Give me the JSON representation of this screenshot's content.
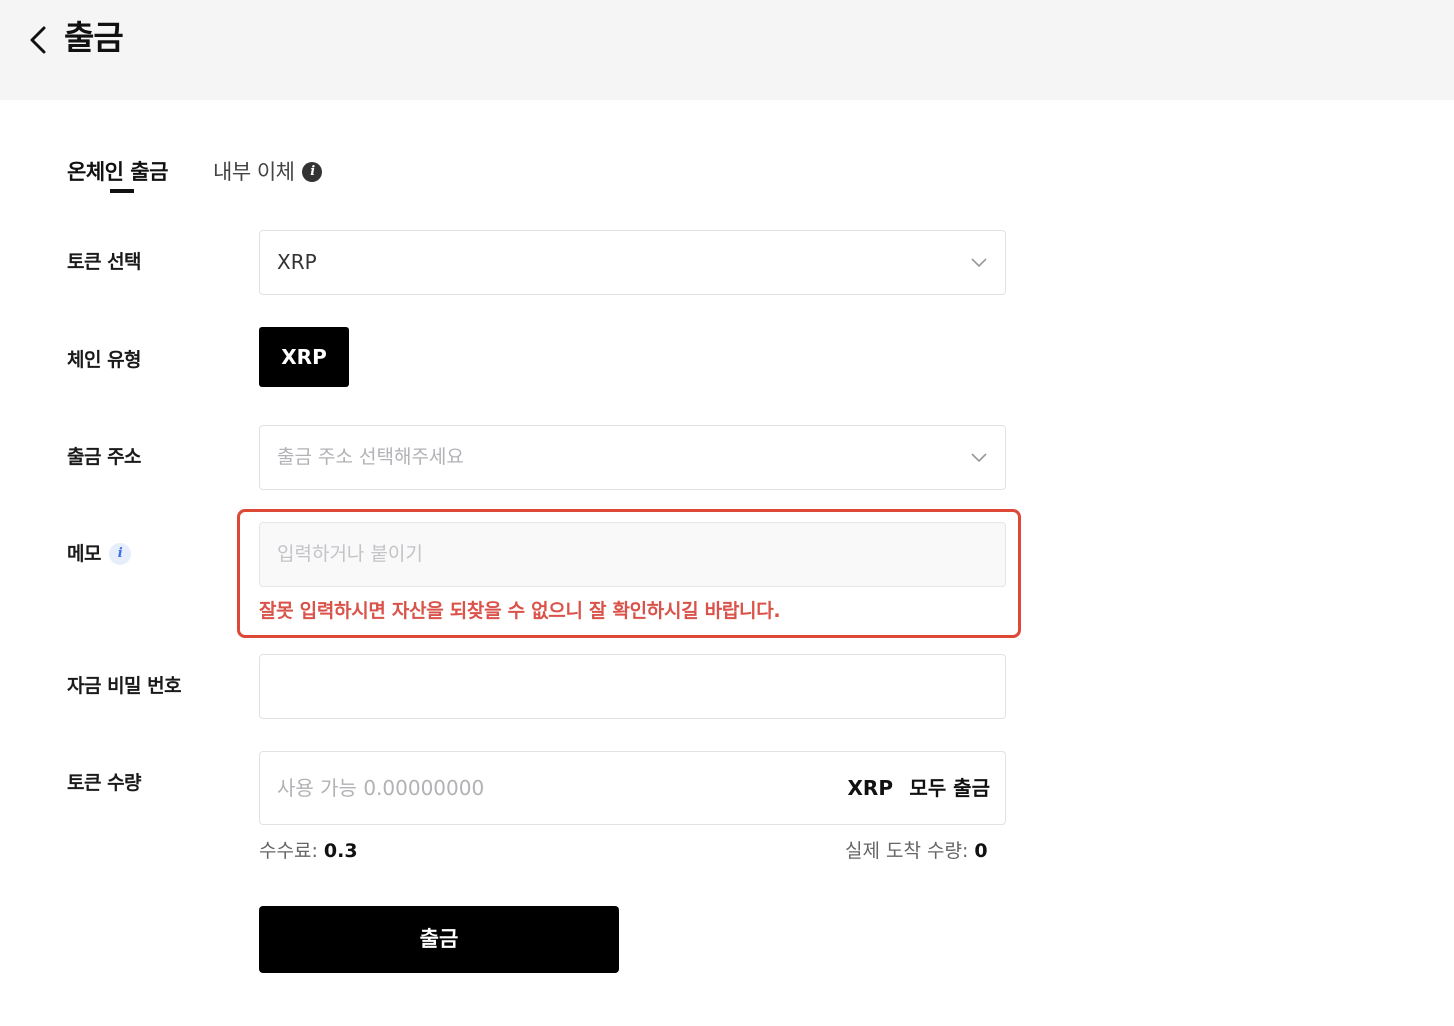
{
  "header": {
    "title": "출금"
  },
  "tabs": {
    "onchain": "온체인 출금",
    "internal": "내부 이체"
  },
  "token_select": {
    "label": "토큰 선택",
    "value": "XRP"
  },
  "chain_type": {
    "label": "체인 유형",
    "selected": "XRP"
  },
  "withdraw_address": {
    "label": "출금 주소",
    "placeholder": "출금 주소 선택해주세요"
  },
  "memo": {
    "label": "메모",
    "placeholder": "입력하거나 붙이기",
    "warning": "잘못 입력하시면 자산을 되찾을 수 없으니 잘 확인하시길 바랍니다."
  },
  "fund_password": {
    "label": "자금 비밀 번호",
    "value": ""
  },
  "amount": {
    "label": "토큰 수량",
    "placeholder": "사용 가능 0.00000000",
    "token": "XRP",
    "withdraw_all": "모두 출금"
  },
  "fee": {
    "label": "수수료: ",
    "value": "0.3"
  },
  "actual_arrival": {
    "label": "실제 도착 수량: ",
    "value": "0"
  },
  "submit_label": "출금",
  "colors": {
    "warning": "#de4836",
    "primary_button": "#000000",
    "header_bg": "#f5f5f6"
  }
}
